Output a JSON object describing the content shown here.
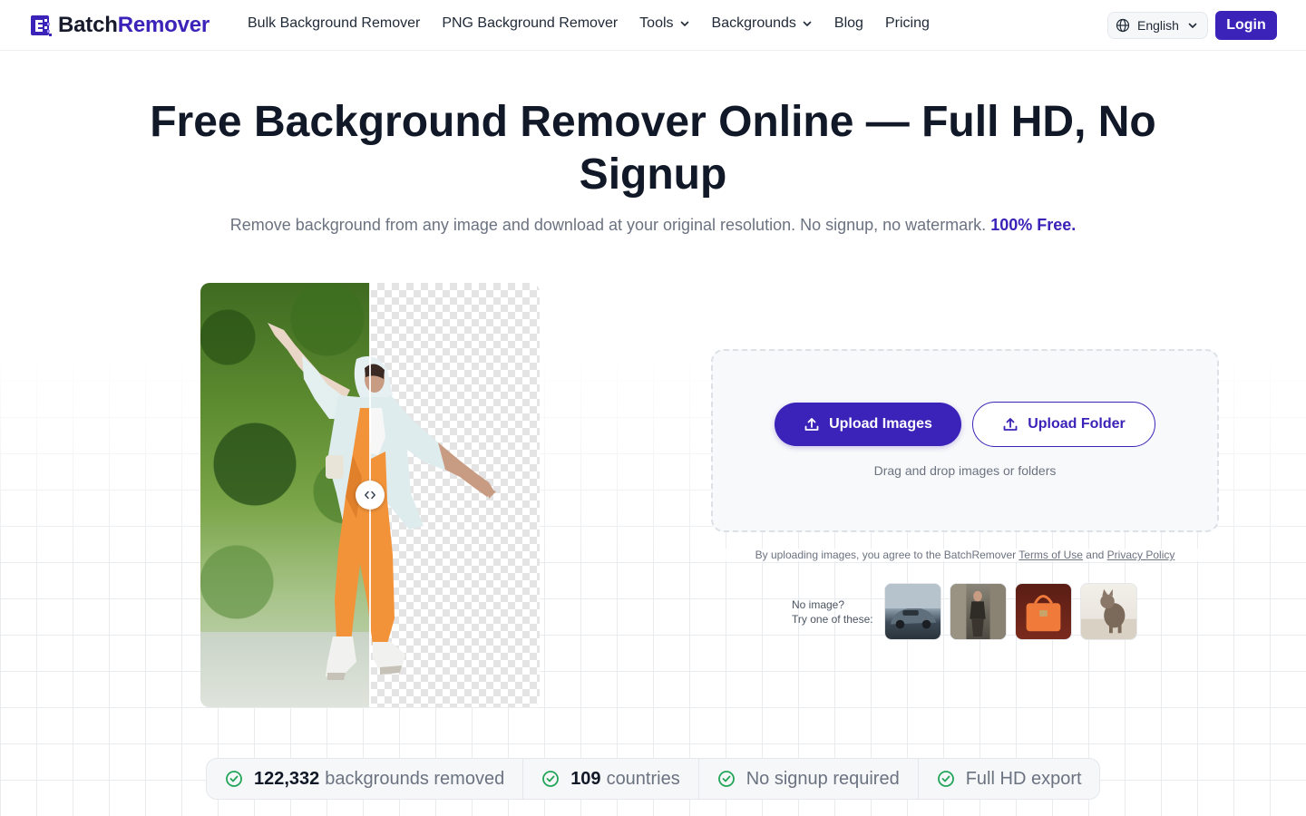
{
  "app": {
    "brand_part1": "Batch",
    "brand_part2": "Remover",
    "accent_color": "#3b22b8"
  },
  "nav": {
    "items": [
      {
        "label": "Bulk Background Remover",
        "dropdown": false
      },
      {
        "label": "PNG Background Remover",
        "dropdown": false
      },
      {
        "label": "Tools",
        "dropdown": true
      },
      {
        "label": "Backgrounds",
        "dropdown": true
      },
      {
        "label": "Blog",
        "dropdown": false
      },
      {
        "label": "Pricing",
        "dropdown": false
      }
    ],
    "language": "English",
    "login_label": "Login"
  },
  "hero": {
    "title": "Free Background Remover Online — Full HD, No Signup",
    "subtitle": "Remove background from any image and download at your original resolution. No signup, no watermark.",
    "subtitle_highlight": "100% Free."
  },
  "compare": {
    "slider_position_percent": 50
  },
  "upload": {
    "upload_images_label": "Upload Images",
    "upload_folder_label": "Upload Folder",
    "drag_hint": "Drag and drop images or folders",
    "terms_prefix": "By uploading images, you agree to the BatchRemover",
    "terms_link": "Terms of Use",
    "terms_and": "and",
    "privacy_link": "Privacy Policy",
    "samples_label_line1": "No image?",
    "samples_label_line2": "Try one of these:"
  },
  "stats": [
    {
      "number": "122,332",
      "text": "backgrounds removed"
    },
    {
      "number": "109",
      "text": "countries"
    },
    {
      "number": "",
      "text": "No signup required"
    },
    {
      "number": "",
      "text": "Full HD export"
    }
  ]
}
